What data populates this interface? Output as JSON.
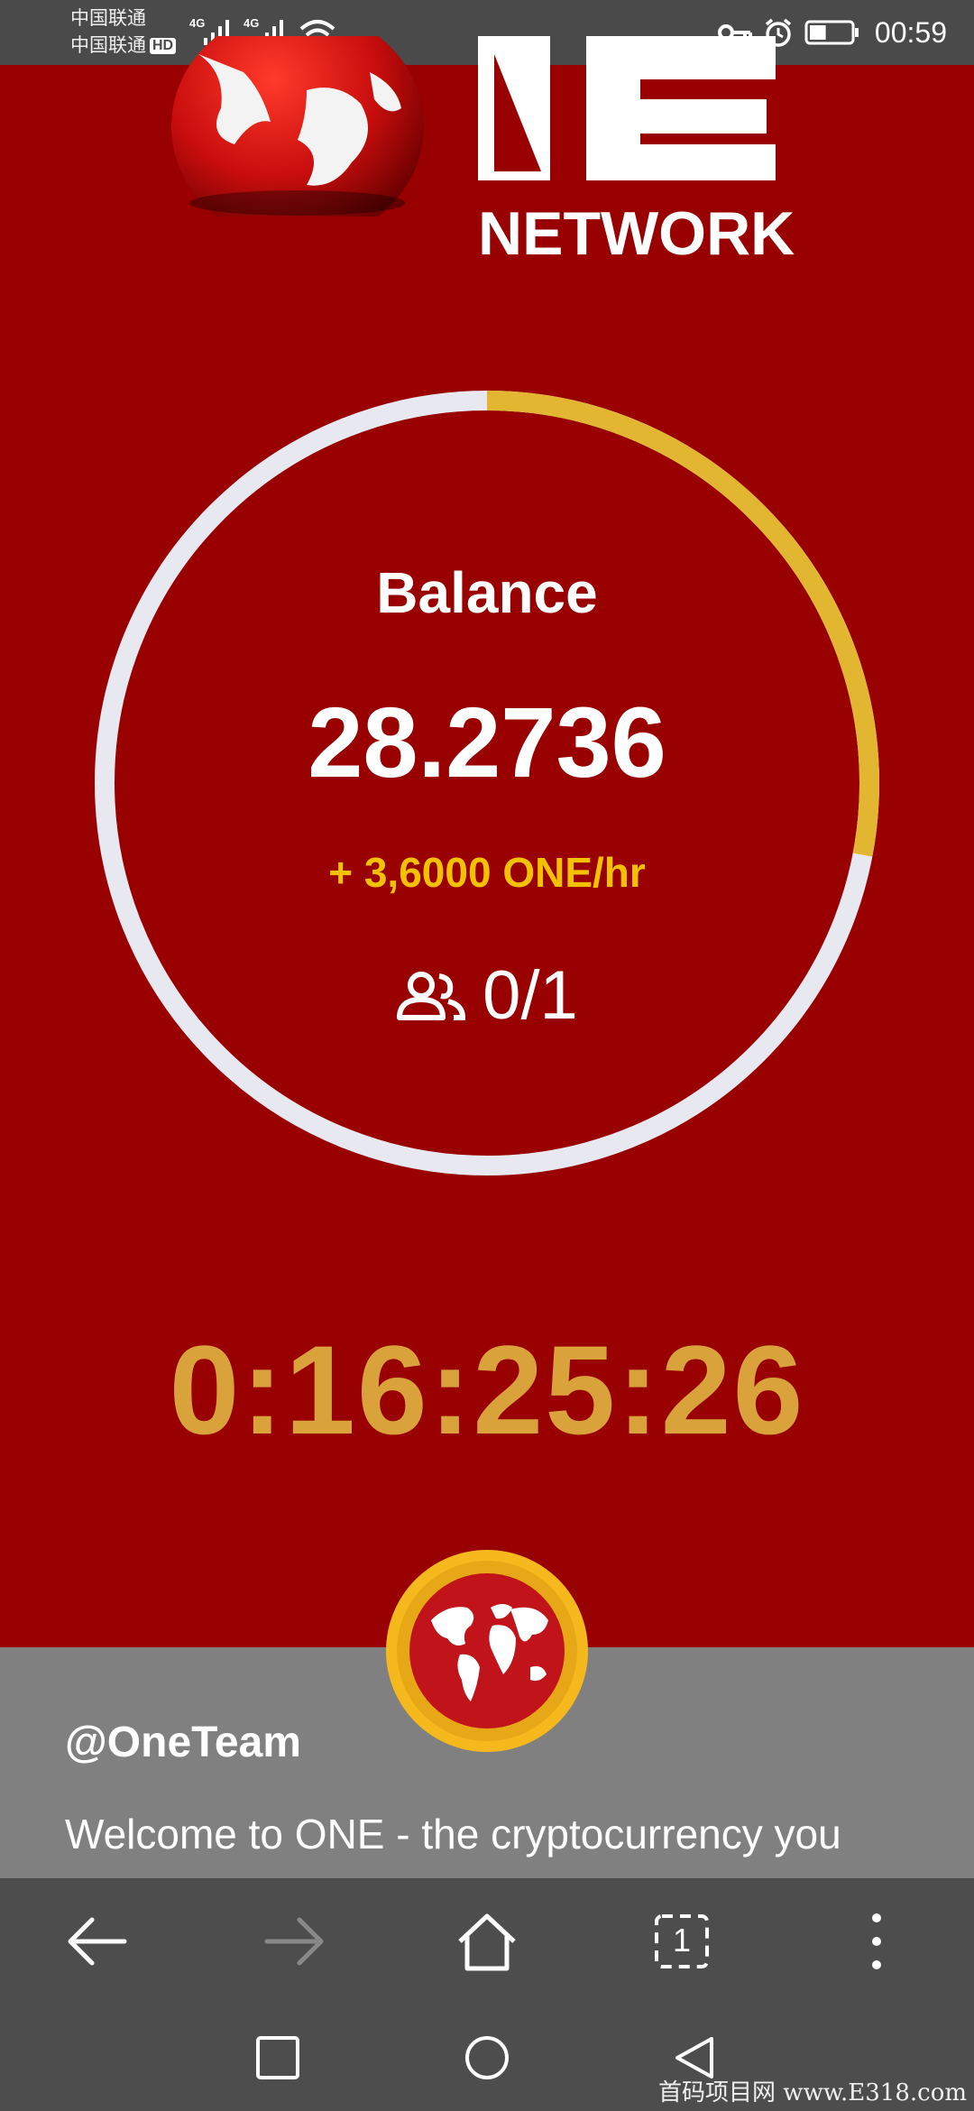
{
  "status_bar": {
    "carrier_1": "中国联通",
    "carrier_2": "中国联通",
    "hd_badge": "HD",
    "network_1": "4G",
    "network_2": "4G",
    "time": "00:59",
    "battery_level_percent": 40
  },
  "header": {
    "logo_word": "NETWORK"
  },
  "mining": {
    "balance_label": "Balance",
    "balance_value": "28.2736",
    "rate": "+ 3,6000 ONE/hr",
    "referrals": "0/1",
    "progress_fraction": 0.28,
    "countdown": "0:16:25:26"
  },
  "news": {
    "author": "@OneTeam",
    "message": "Welcome to ONE - the cryptocurrency you"
  },
  "colors": {
    "background": "#990000",
    "ring_track": "#e8e8f0",
    "ring_progress": "#e2b630",
    "accent_gold": "#d9a23a",
    "panel": "#808080",
    "toolbar": "#4d4d4d"
  },
  "browser_toolbar": {
    "tab_count": "1"
  },
  "watermark": "首码项目网 www.E318.com"
}
